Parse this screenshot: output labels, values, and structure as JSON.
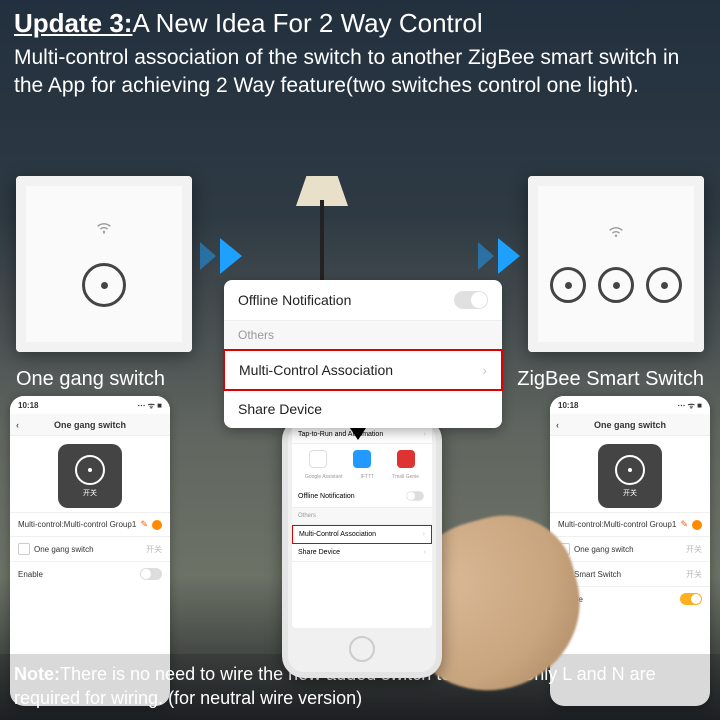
{
  "header": {
    "title_prefix": "Update 3:",
    "title_main": "A New Idea For 2 Way Control",
    "description": "Multi-control association of the switch to another ZigBee smart switch in the App for achieving 2 Way feature(two switches control one light)."
  },
  "switch_labels": {
    "left": "One gang switch",
    "right": "ZigBee Smart Switch"
  },
  "popup": {
    "offline": "Offline Notification",
    "section": "Others",
    "multi": "Multi-Control Association",
    "share": "Share Device"
  },
  "phone_left": {
    "time": "10:18",
    "indicators": "⋯ ᯤ ■",
    "title": "One gang switch",
    "tile_caption": "开关",
    "group": "Multi-control:Multi-control Group1",
    "row1": "One gang switch",
    "row1_right": "开关",
    "enable": "Enable"
  },
  "phone_right": {
    "time": "10:18",
    "indicators": "⋯ ᯤ ■",
    "title": "One gang switch",
    "tile_caption": "开关",
    "group": "Multi-control:Multi-control Group1",
    "row1": "One gang switch",
    "row1_right": "开关",
    "row2": "Smart Switch",
    "row2_right": "开关",
    "enable": "Enable"
  },
  "center_phone": {
    "tap": "Tap-to-Run and Automation",
    "assist_row": [
      "Google Assistant",
      "IFTTT",
      "Tmall Genie"
    ],
    "offline": "Offline Notification",
    "others": "Others",
    "multi": "Multi-Control Association",
    "share": "Share Device"
  },
  "note": {
    "prefix": "Note:",
    "text": "There is no need to wire the new added switch to the light,only L and N are required for wiring.  (for neutral wire version)"
  }
}
